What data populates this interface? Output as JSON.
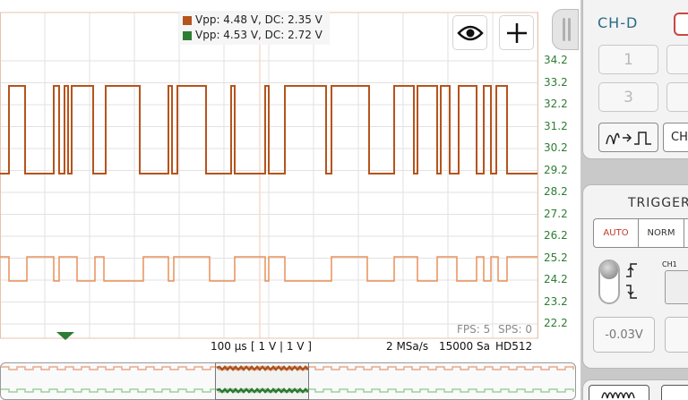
{
  "legend": {
    "ch1": {
      "text": "Vpp: 4.48 V, DC: 2.35 V",
      "color": "#b5541c"
    },
    "ch2": {
      "text": "Vpp: 4.53 V, DC: 2.72 V",
      "color": "#2e7d32"
    }
  },
  "toolbar": {
    "eye_icon": "eye-icon",
    "plus_icon": "plus-icon"
  },
  "y_axis_labels": [
    "34.2",
    "33.2",
    "32.2",
    "31.2",
    "30.2",
    "29.2",
    "28.2",
    "27.2",
    "26.2",
    "25.2",
    "24.2",
    "23.2",
    "22.2"
  ],
  "stats": {
    "fps": "FPS: 5",
    "sps": "SPS: 0"
  },
  "status_bar": {
    "timebase": "100 µs",
    "volts": "[ 1 V | 1 V ]",
    "sample_rate": "2 MSa/s",
    "samples": "15000 Sa",
    "mode": "HD512"
  },
  "colors": {
    "trace_primary": "#b5541c",
    "trace_secondary": "#e8915a",
    "trigger_marker": "#2e7d32",
    "grid": "#e2e2e2",
    "center_line": "#f0c9b5"
  },
  "channel_panel": {
    "title": "CH-D",
    "buttons": [
      "1",
      "3"
    ],
    "ch_button": "CH"
  },
  "trigger_panel": {
    "title": "TRIGGER",
    "modes": {
      "auto": "AUTO",
      "norm": "NORM"
    },
    "source_label": "CH1",
    "level": "-0.03V"
  }
}
